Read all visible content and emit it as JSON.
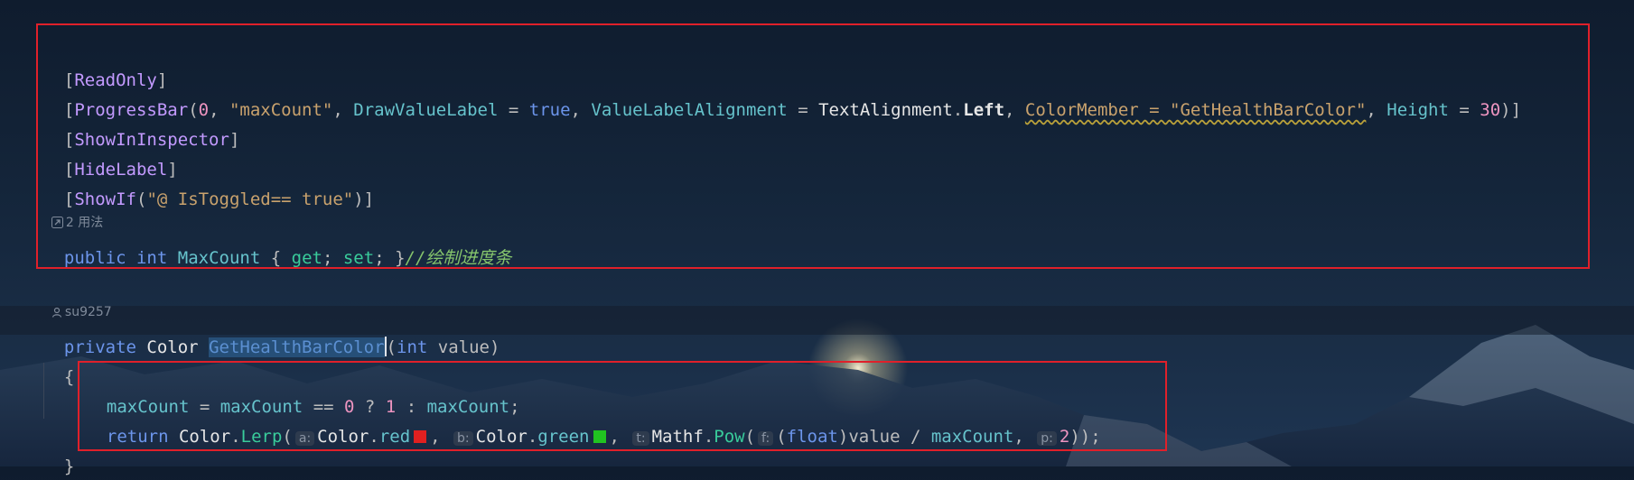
{
  "attributes_block": {
    "line1": {
      "open": "[",
      "name": "ReadOnly",
      "close": "]"
    },
    "line2": {
      "open": "[",
      "name": "ProgressBar",
      "paren_open": "(",
      "arg0": "0",
      "comma": ", ",
      "arg1": "\"maxCount\"",
      "draw_value_label": "DrawValueLabel",
      "eq": " = ",
      "true_kw": "true",
      "value_label_alignment": "ValueLabelAlignment",
      "text_alignment": "TextAlignment",
      "dot": ".",
      "left": "Left",
      "color_member": "ColorMember = \"GetHealthBarColor\"",
      "height": "Height",
      "height_val": "30",
      "close": ")]"
    },
    "line3": {
      "open": "[",
      "name": "ShowInInspector",
      "close": "]"
    },
    "line4": {
      "open": "[",
      "name": "HideLabel",
      "close": "]"
    },
    "line5": {
      "open": "[",
      "name": "ShowIf",
      "paren_open": "(",
      "arg": "\"@ IsToggled== true\"",
      "close": ")]"
    },
    "usages_hint": "2 用法",
    "declaration": {
      "public_kw": "public",
      "int_kw": "int",
      "name": "MaxCount",
      "brace_open": "{",
      "get": "get",
      "set": "set",
      "brace_close": "}",
      "comment": "//绘制进度条"
    }
  },
  "author_hint": "su9257",
  "method": {
    "private_kw": "private",
    "return_type": "Color",
    "name": "GetHealthBarColor",
    "paren_open": "(",
    "param_type": "int",
    "param_name": "value",
    "paren_close": ")",
    "brace_open": "{",
    "brace_close": "}"
  },
  "body_line1": {
    "var": "maxCount",
    "op1": " = ",
    "var2": "maxCount",
    "op2": " == ",
    "zero": "0",
    "op3": " ? ",
    "one": "1",
    "op4": " : ",
    "var3": "maxCount",
    "end": ";"
  },
  "body_line2": {
    "return_kw": "return",
    "color_cls": "Color",
    "dot": ".",
    "lerp": "Lerp",
    "paren": "(",
    "hint_a": "a:",
    "red_cls": "Color",
    "red": "red",
    "hint_b": "b:",
    "green_cls": "Color",
    "green": "green",
    "hint_t": "t:",
    "mathf": "Mathf",
    "pow": "Pow",
    "hint_f": "f:",
    "float_kw": "float",
    "value": "value",
    "slash": " / ",
    "maxcount": "maxCount",
    "hint_p": "p:",
    "two": "2",
    "end": "));"
  },
  "colors": {
    "highlight_box": "#e0202a",
    "swatch_red": "#e02020",
    "swatch_green": "#21c321"
  }
}
